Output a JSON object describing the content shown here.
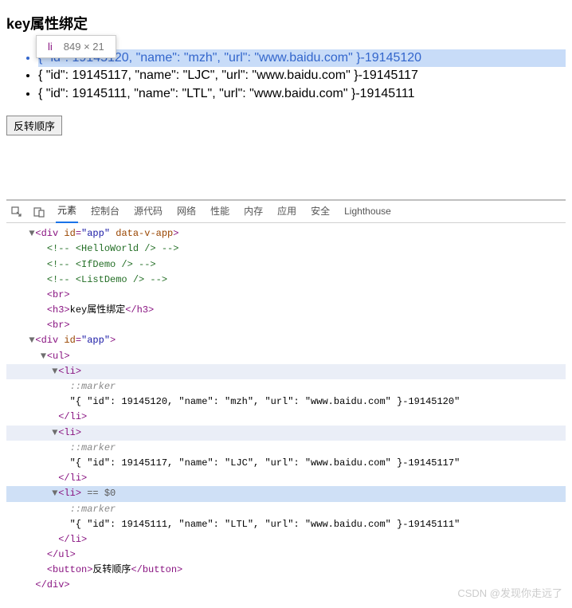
{
  "heading": "key属性绑定",
  "tooltip": {
    "tag": "li",
    "dimensions": "849 × 21"
  },
  "list": [
    {
      "text": "{ \"id\": 19145120, \"name\": \"mzh\", \"url\": \"www.baidu.com\" }-19145120",
      "highlighted": true
    },
    {
      "text": "{ \"id\": 19145117, \"name\": \"LJC\", \"url\": \"www.baidu.com\" }-19145117",
      "highlighted": false
    },
    {
      "text": "{ \"id\": 19145111, \"name\": \"LTL\", \"url\": \"www.baidu.com\" }-19145111",
      "highlighted": false
    }
  ],
  "button_label": "反转顺序",
  "devtools": {
    "tabs": [
      "元素",
      "控制台",
      "源代码",
      "网络",
      "性能",
      "内存",
      "应用",
      "安全",
      "Lighthouse"
    ],
    "active_tab": "元素",
    "lines": [
      {
        "indent": 1,
        "triangle": "▼",
        "html": "<span class='p'>&lt;div <span class='a'>id</span>=<span class='v'>\"app\"</span> <span class='a'>data-v-app</span>&gt;</span>",
        "cls": ""
      },
      {
        "indent": 2,
        "triangle": "",
        "html": "<span class='c'>&lt;!-- &lt;HelloWorld /&gt; --&gt;</span>",
        "cls": ""
      },
      {
        "indent": 2,
        "triangle": "",
        "html": "<span class='c'>&lt;!-- &lt;IfDemo /&gt; --&gt;</span>",
        "cls": ""
      },
      {
        "indent": 2,
        "triangle": "",
        "html": "<span class='c'>&lt;!-- &lt;ListDemo /&gt; --&gt;</span>",
        "cls": ""
      },
      {
        "indent": 2,
        "triangle": "",
        "html": "<span class='p'>&lt;br&gt;</span>",
        "cls": ""
      },
      {
        "indent": 2,
        "triangle": "",
        "html": "<span class='p'>&lt;h3&gt;</span>key属性绑定<span class='p'>&lt;/h3&gt;</span>",
        "cls": ""
      },
      {
        "indent": 2,
        "triangle": "",
        "html": "<span class='p'>&lt;br&gt;</span>",
        "cls": ""
      },
      {
        "indent": 1,
        "triangle": "▼",
        "html": "<span class='p'>&lt;div <span class='a'>id</span>=<span class='v'>\"app\"</span>&gt;</span>",
        "cls": ""
      },
      {
        "indent": 2,
        "triangle": "▼",
        "html": "<span class='p'>&lt;ul&gt;</span>",
        "cls": ""
      },
      {
        "indent": 3,
        "triangle": "▼",
        "html": "<span class='p'>&lt;li&gt;</span>",
        "cls": "hov"
      },
      {
        "indent": 4,
        "triangle": "",
        "html": "<span class='m'>::marker</span>",
        "cls": ""
      },
      {
        "indent": 4,
        "triangle": "",
        "html": "\"{ \"id\": 19145120, \"name\": \"mzh\", \"url\": \"www.baidu.com\" }-19145120\"",
        "cls": ""
      },
      {
        "indent": 3,
        "triangle": "",
        "html": "<span class='p'>&lt;/li&gt;</span>",
        "cls": ""
      },
      {
        "indent": 3,
        "triangle": "▼",
        "html": "<span class='p'>&lt;li&gt;</span>",
        "cls": "hov"
      },
      {
        "indent": 4,
        "triangle": "",
        "html": "<span class='m'>::marker</span>",
        "cls": ""
      },
      {
        "indent": 4,
        "triangle": "",
        "html": "\"{ \"id\": 19145117, \"name\": \"LJC\", \"url\": \"www.baidu.com\" }-19145117\"",
        "cls": ""
      },
      {
        "indent": 3,
        "triangle": "",
        "html": "<span class='p'>&lt;/li&gt;</span>",
        "cls": ""
      },
      {
        "indent": 3,
        "triangle": "▼",
        "html": "<span class='p'>&lt;li&gt;</span> <span class='eq'>== $0</span>",
        "cls": "sel"
      },
      {
        "indent": 4,
        "triangle": "",
        "html": "<span class='m'>::marker</span>",
        "cls": ""
      },
      {
        "indent": 4,
        "triangle": "",
        "html": "\"{ \"id\": 19145111, \"name\": \"LTL\", \"url\": \"www.baidu.com\" }-19145111\"",
        "cls": ""
      },
      {
        "indent": 3,
        "triangle": "",
        "html": "<span class='p'>&lt;/li&gt;</span>",
        "cls": ""
      },
      {
        "indent": 2,
        "triangle": "",
        "html": "<span class='p'>&lt;/ul&gt;</span>",
        "cls": ""
      },
      {
        "indent": 2,
        "triangle": "",
        "html": "<span class='p'>&lt;button&gt;</span>反转顺序<span class='p'>&lt;/button&gt;</span>",
        "cls": ""
      },
      {
        "indent": 1,
        "triangle": "",
        "html": "<span class='p'>&lt;/div&gt;</span>",
        "cls": ""
      }
    ]
  },
  "watermark": "CSDN @发现你走远了"
}
